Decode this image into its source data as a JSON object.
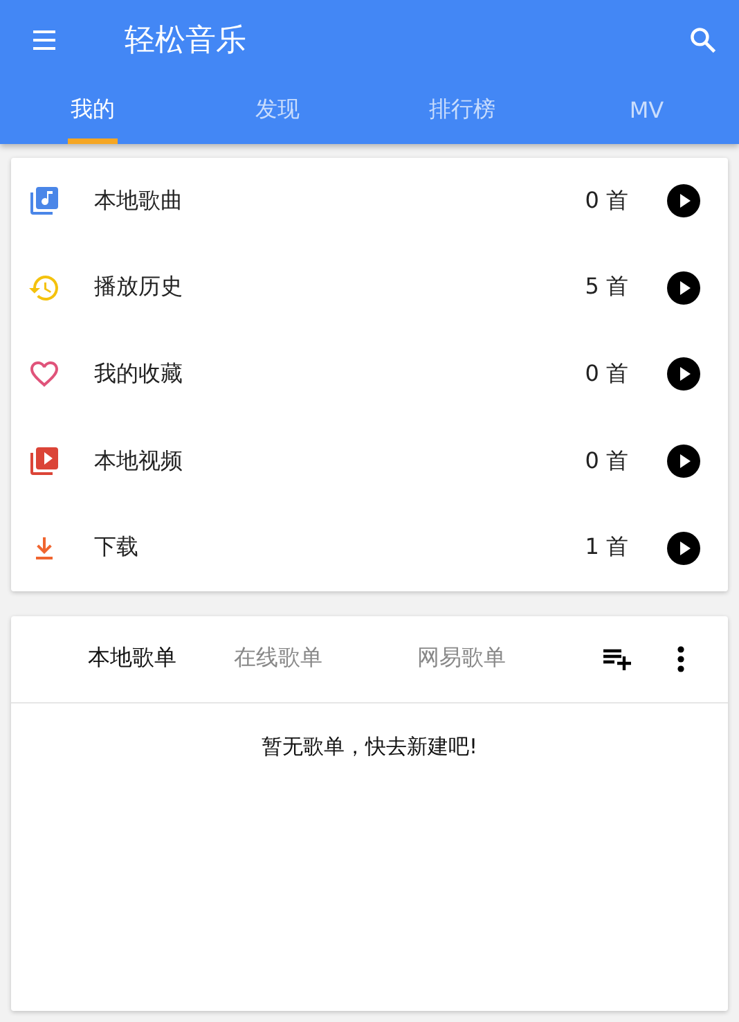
{
  "app_bar": {
    "title": "轻松音乐"
  },
  "tabs": [
    {
      "label": "我的",
      "selected": true
    },
    {
      "label": "发现",
      "selected": false
    },
    {
      "label": "排行榜",
      "selected": false
    },
    {
      "label": "MV",
      "selected": false
    }
  ],
  "library": [
    {
      "kind": "music",
      "color": "#4a86e8",
      "label": "本地歌曲",
      "count": "0 首"
    },
    {
      "kind": "history",
      "color": "#f4c20d",
      "label": "播放历史",
      "count": "5 首"
    },
    {
      "kind": "heart",
      "color": "#e0537a",
      "label": "我的收藏",
      "count": "0 首"
    },
    {
      "kind": "video",
      "color": "#db4437",
      "label": "本地视频",
      "count": "0 首"
    },
    {
      "kind": "download",
      "color": "#f0652f",
      "label": "下载",
      "count": "1 首"
    }
  ],
  "playlists": {
    "tabs": [
      {
        "label": "本地歌单",
        "selected": true
      },
      {
        "label": "在线歌单",
        "selected": false
      },
      {
        "label": "网易歌单",
        "selected": false
      }
    ],
    "empty_message": "暂无歌单，快去新建吧!"
  }
}
